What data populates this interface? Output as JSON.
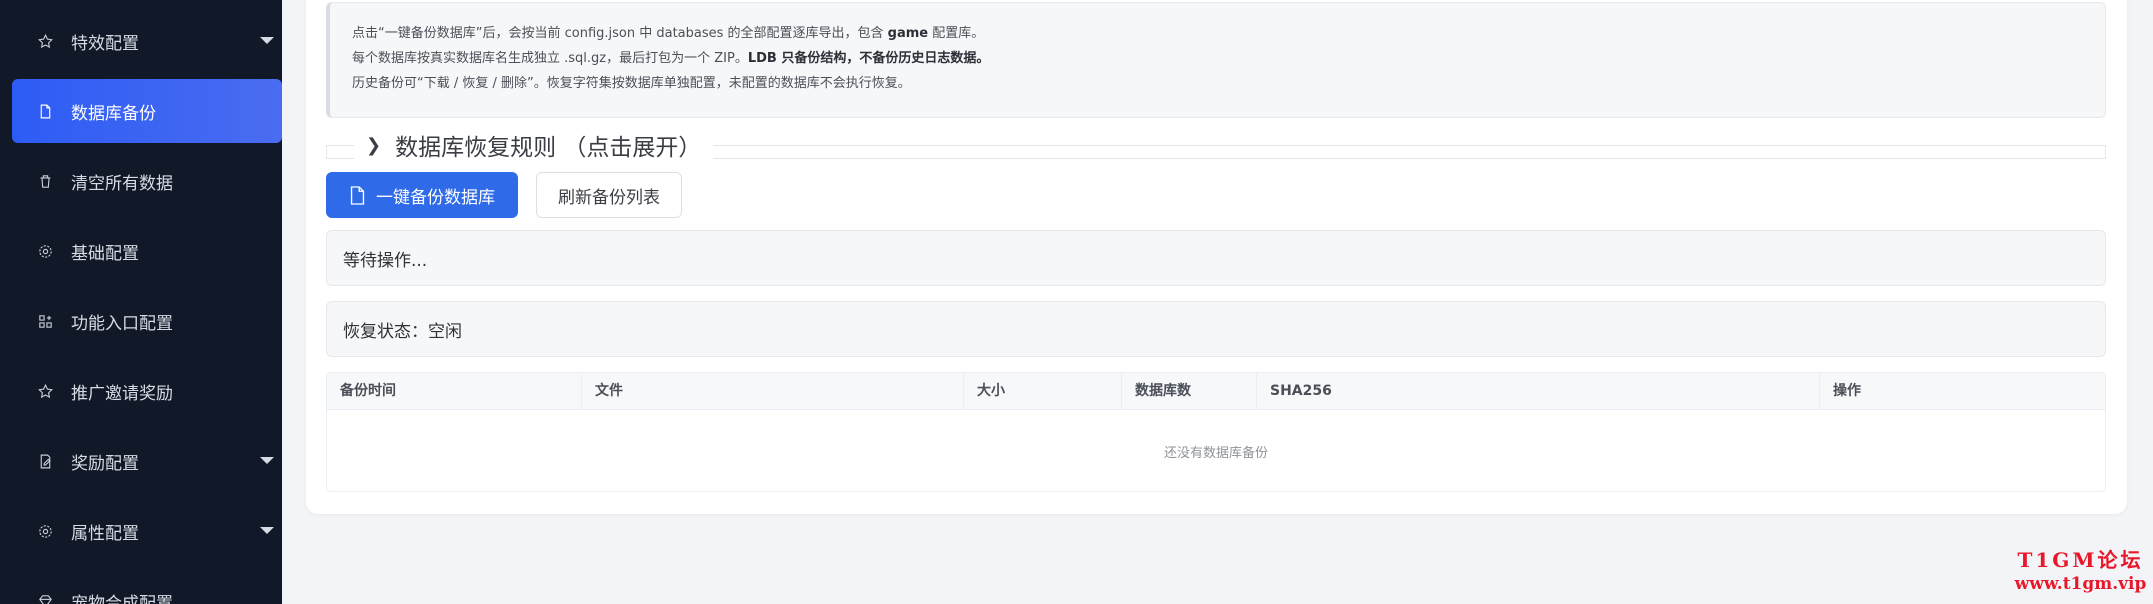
{
  "sidebar": {
    "items": [
      {
        "label": "特效配置",
        "icon": "star-icon",
        "expandable": true,
        "active": false
      },
      {
        "label": "数据库备份",
        "icon": "document-icon",
        "expandable": false,
        "active": true
      },
      {
        "label": "清空所有数据",
        "icon": "trash-icon",
        "expandable": false,
        "active": false
      },
      {
        "label": "基础配置",
        "icon": "gear-icon",
        "expandable": false,
        "active": false
      },
      {
        "label": "功能入口配置",
        "icon": "grid-icon",
        "expandable": false,
        "active": false
      },
      {
        "label": "推广邀请奖励",
        "icon": "star-icon",
        "expandable": false,
        "active": false
      },
      {
        "label": "奖励配置",
        "icon": "edit-icon",
        "expandable": true,
        "active": false
      },
      {
        "label": "属性配置",
        "icon": "gear-icon",
        "expandable": true,
        "active": false
      },
      {
        "label": "宠物合成配置",
        "icon": "gem-icon",
        "expandable": false,
        "active": false
      }
    ]
  },
  "notice": {
    "line1_a": "点击“一键备份数据库”后，会按当前 config.json 中 databases 的全部配置逐库导出，包含 ",
    "line1_b": "game",
    "line1_c": " 配置库。",
    "line2_a": "每个数据库按真实数据库名生成独立 .sql.gz，最后打包为一个 ZIP。",
    "line2_b": "LDB 只备份结构，不备份历史日志数据。",
    "line3": "历史备份可“下载 / 恢复 / 删除”。恢复字符集按数据库单独配置，未配置的数据库不会执行恢复。"
  },
  "restore_rules": {
    "label": "数据库恢复规则 （点击展开）"
  },
  "actions": {
    "backup_label": "一键备份数据库",
    "refresh_label": "刷新备份列表"
  },
  "status": {
    "operation": "等待操作...",
    "restore": "恢复状态：空闲"
  },
  "table": {
    "columns": [
      "备份时间",
      "文件",
      "大小",
      "数据库数",
      "SHA256",
      "操作"
    ],
    "empty_text": "还没有数据库备份"
  },
  "watermark": {
    "line1": "T1GM论坛",
    "line2": "www.t1gm.vip"
  },
  "colors": {
    "sidebar_bg": "#111827",
    "active_item": "#2d5cf5",
    "primary_button": "#2f6be8",
    "watermark": "#e8182a"
  }
}
